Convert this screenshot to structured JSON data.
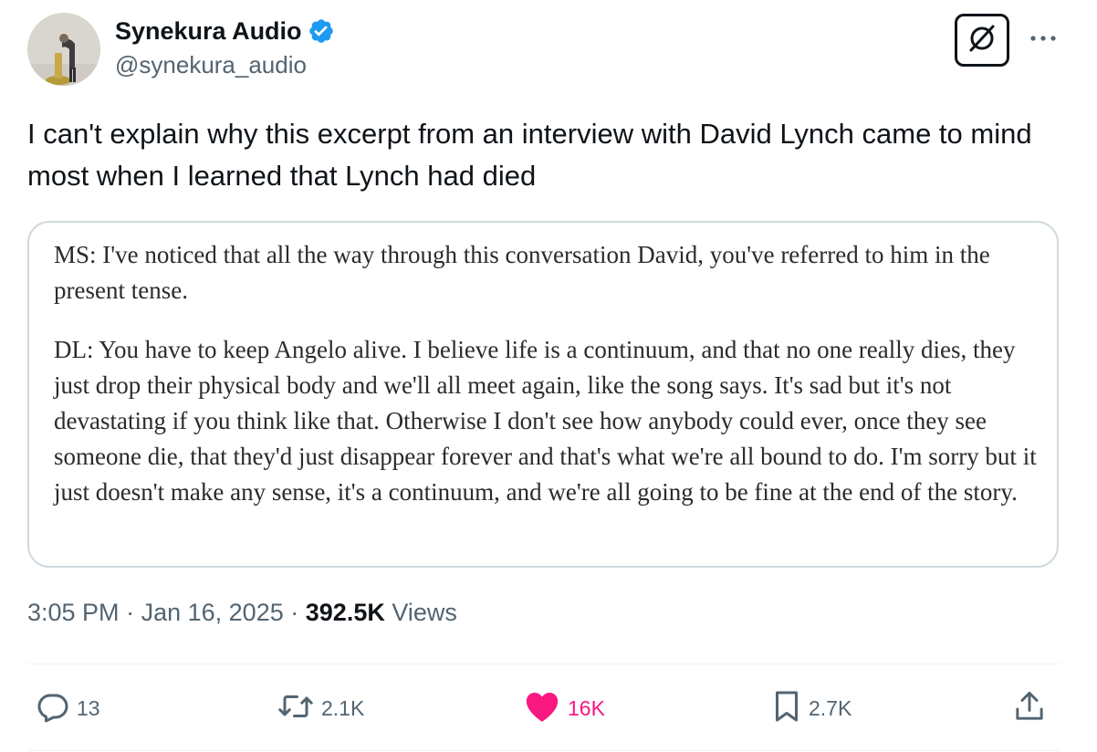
{
  "author": {
    "display_name": "Synekura Audio",
    "handle": "@synekura_audio",
    "verified": true
  },
  "tweet": {
    "text": "I can't explain why this excerpt from an interview with David Lynch came to mind most when I learned that Lynch had died",
    "quote": {
      "paragraphs": [
        "MS: I've noticed that all the way through this conversation David, you've referred to him in the present tense.",
        "DL: You have to keep Angelo alive. I believe life is a continuum, and that no one really dies, they just drop their physical body and we'll all meet again, like the song says. It's sad but it's not devastating if you think like that. Otherwise I don't see how anybody could ever, once they see someone die, that they'd just disappear forever and that's what we're all bound to do. I'm sorry but it just doesn't make any sense, it's a continuum, and we're all going to be fine at the end of the story."
      ]
    },
    "time": "3:05 PM",
    "separator": "·",
    "date": "Jan 16, 2025",
    "views_count": "392.5K",
    "views_label": "Views"
  },
  "actions": {
    "replies": "13",
    "reposts": "2.1K",
    "likes": "16K",
    "bookmarks": "2.7K"
  },
  "colors": {
    "text_primary": "#0f1419",
    "text_secondary": "#536471",
    "verified_blue": "#1d9bf0",
    "like_pink": "#f91880",
    "border": "#cfd9de"
  },
  "icons": {
    "verified": "verified-badge-icon",
    "grok": "grok-icon",
    "more": "more-icon",
    "reply": "reply-icon",
    "repost": "repost-icon",
    "like": "heart-icon",
    "bookmark": "bookmark-icon",
    "share": "share-icon"
  }
}
